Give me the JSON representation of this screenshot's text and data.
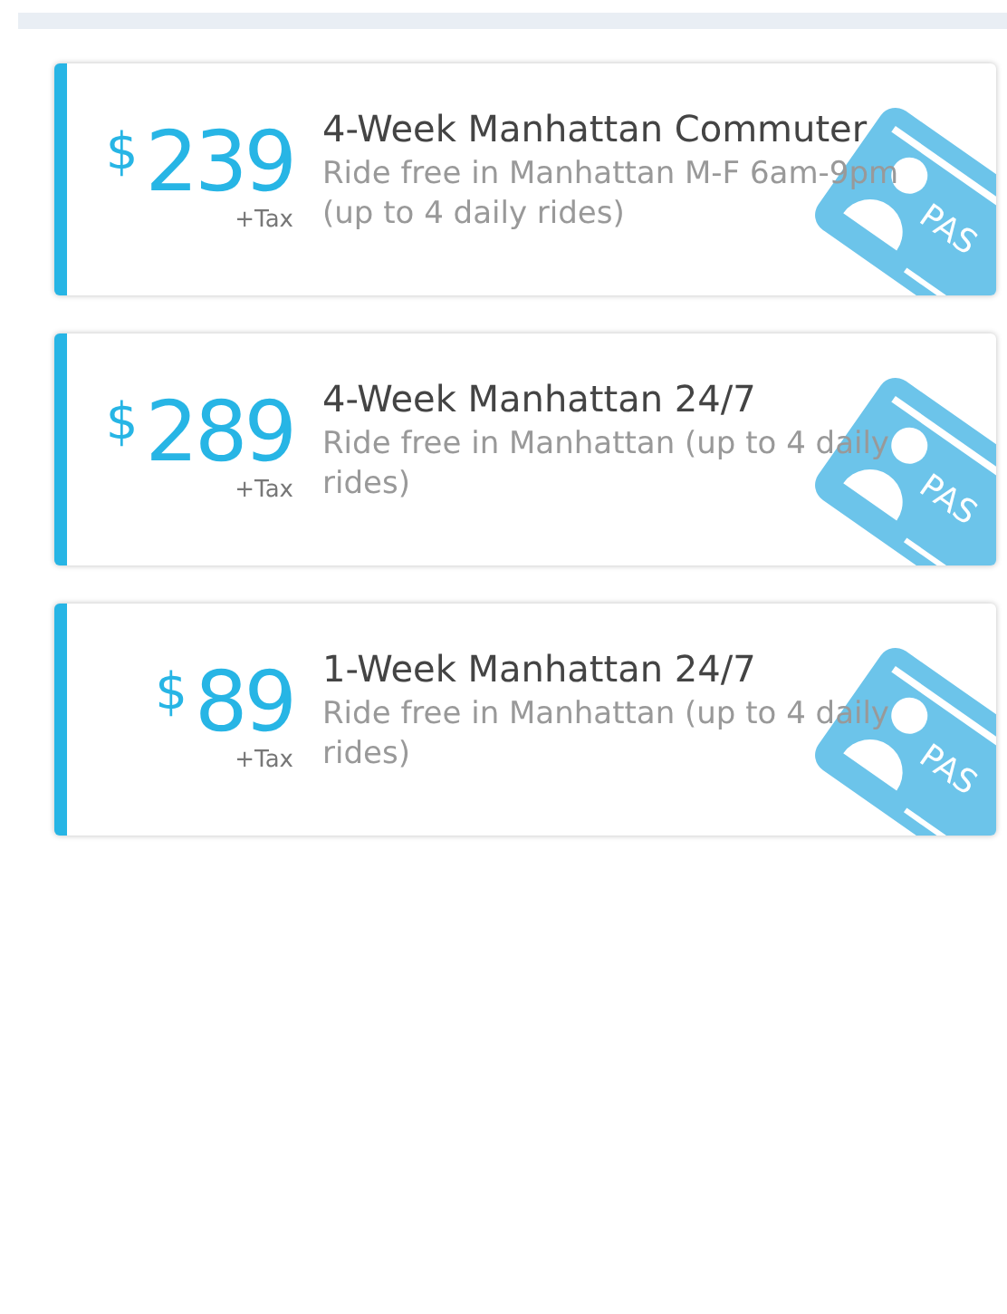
{
  "passes": [
    {
      "currency": "$",
      "price": "239",
      "tax": "+Tax",
      "title": "4-Week Manhattan Commuter",
      "description": "Ride free in Manhattan M-F 6am-9pm (up to 4 daily rides)",
      "pass_label": "PAS"
    },
    {
      "currency": "$",
      "price": "289",
      "tax": "+Tax",
      "title": "4-Week Manhattan 24/7",
      "description": "Ride free in Manhattan (up to 4 daily rides)",
      "pass_label": "PAS"
    },
    {
      "currency": "$",
      "price": "89",
      "tax": "+Tax",
      "title": "1-Week Manhattan 24/7",
      "description": "Ride free in Manhattan (up to 4 daily rides)",
      "pass_label": "PAS"
    }
  ]
}
